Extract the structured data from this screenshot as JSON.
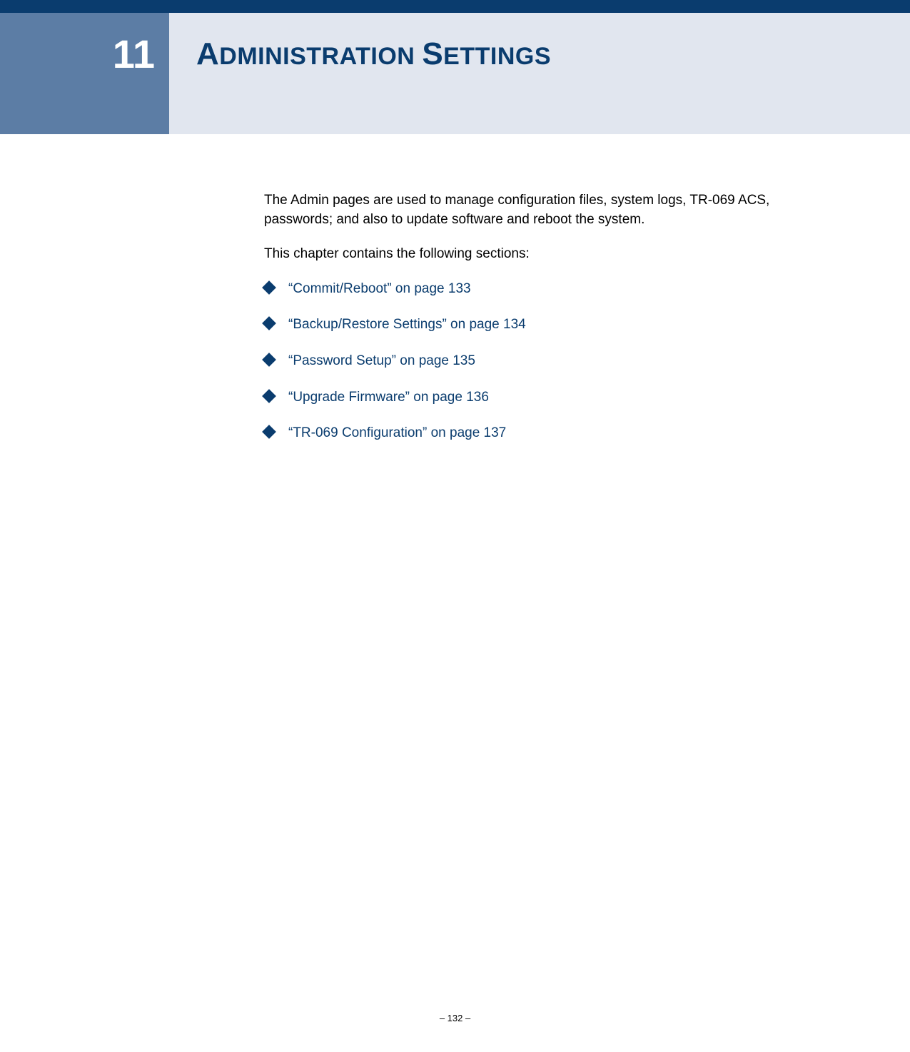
{
  "chapter": {
    "number": "11",
    "title_first_letter_1": "A",
    "title_rest_1": "DMINISTRATION",
    "title_first_letter_2": "S",
    "title_rest_2": "ETTINGS"
  },
  "content": {
    "intro": "The Admin pages are used to manage configuration files, system logs, TR-069 ACS, passwords; and also to update software and reboot the system.",
    "sections_lead": "This chapter contains the following sections:",
    "links": [
      "“Commit/Reboot” on page 133",
      "“Backup/Restore Settings” on page 134",
      "“Password Setup” on page 135",
      "“Upgrade Firmware” on page 136",
      "“TR-069 Configuration” on page 137"
    ]
  },
  "footer": {
    "page_number": "–  132  –"
  }
}
